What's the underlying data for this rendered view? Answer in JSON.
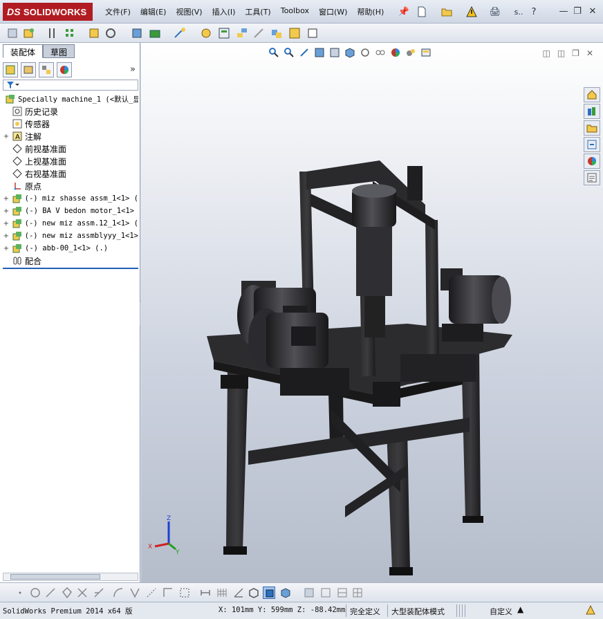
{
  "app": {
    "brand": "SOLIDWORKS",
    "brand_prefix": "DS"
  },
  "menubar": {
    "items": [
      {
        "label": "文件(F)"
      },
      {
        "label": "编辑(E)"
      },
      {
        "label": "视图(V)"
      },
      {
        "label": "插入(I)"
      },
      {
        "label": "工具(T)"
      },
      {
        "label": "Toolbox"
      },
      {
        "label": "窗口(W)"
      },
      {
        "label": "帮助(H)"
      }
    ],
    "search_label": "s.."
  },
  "panel": {
    "tabs": [
      {
        "label": "装配体"
      },
      {
        "label": "草图"
      }
    ],
    "tree": {
      "root": "Specially machine_1  (<默认_显",
      "items": [
        {
          "label": "历史记录"
        },
        {
          "label": "传感器"
        },
        {
          "label": "注解"
        },
        {
          "label": "前视基准面"
        },
        {
          "label": "上视基准面"
        },
        {
          "label": "右视基准面"
        },
        {
          "label": "原点"
        },
        {
          "label": "(-) miz shasse assm_1<1> ("
        },
        {
          "label": "(-) BA V bedon motor_1<1>"
        },
        {
          "label": "(-) new miz assm.12_1<1> ("
        },
        {
          "label": "(-) new miz assmblyyy_1<1>"
        },
        {
          "label": "(-) abb-00_1<1> (.)"
        },
        {
          "label": "配合"
        }
      ]
    }
  },
  "triad": {
    "x": "X",
    "y": "Y",
    "z": "Z"
  },
  "status": {
    "product": "SolidWorks Premium 2014 x64 版",
    "coords": "X: 101mm Y: 599mm Z: -88.42mm",
    "definition": "完全定义",
    "mode": "大型装配体模式",
    "units": "自定义"
  }
}
